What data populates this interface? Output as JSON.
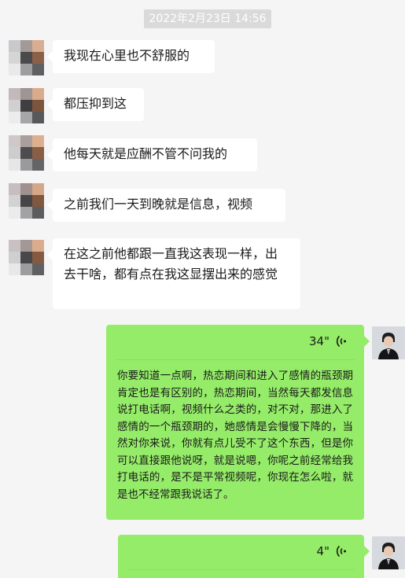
{
  "timestamp": "2022年2月23日 14:56",
  "messages_left": [
    {
      "text": "我现在心里也不舒服的"
    },
    {
      "text": "都压抑到这"
    },
    {
      "text": "他每天就是应酬不管不问我的"
    },
    {
      "text": "之前我们一天到晚就是信息，视频"
    },
    {
      "text": "在这之前他都跟一直我这表现一样，出去干啥，都有点在我这显摆出来的感觉"
    }
  ],
  "voice_messages": [
    {
      "duration": "34\"",
      "transcript": "你要知道一点啊，热恋期间和进入了感情的瓶颈期肯定也是有区别的，热恋期间，当然每天都发信息说打电话啊，视频什么之类的，对不对，那进入了感情的一个瓶颈期的，她感情是会慢慢下降的，当然对你来说，你就有点儿受不了这个东西，但是你可以直接跟他说呀，就是说嗯，你呢之前经常给我打电话的，是不是平常视频呢，你现在怎么啦，就是也不经常跟我说话了。"
    },
    {
      "duration": "4\"",
      "transcript": ""
    }
  ],
  "colors": {
    "background": "#f5f5f5",
    "bubble_left": "#ffffff",
    "bubble_right": "#95ec69",
    "timestamp_bg": "#dadada"
  },
  "icons": {
    "voice": "voice-wave-icon",
    "avatar_left": "pixelated-avatar",
    "avatar_right": "user-avatar-photo"
  }
}
